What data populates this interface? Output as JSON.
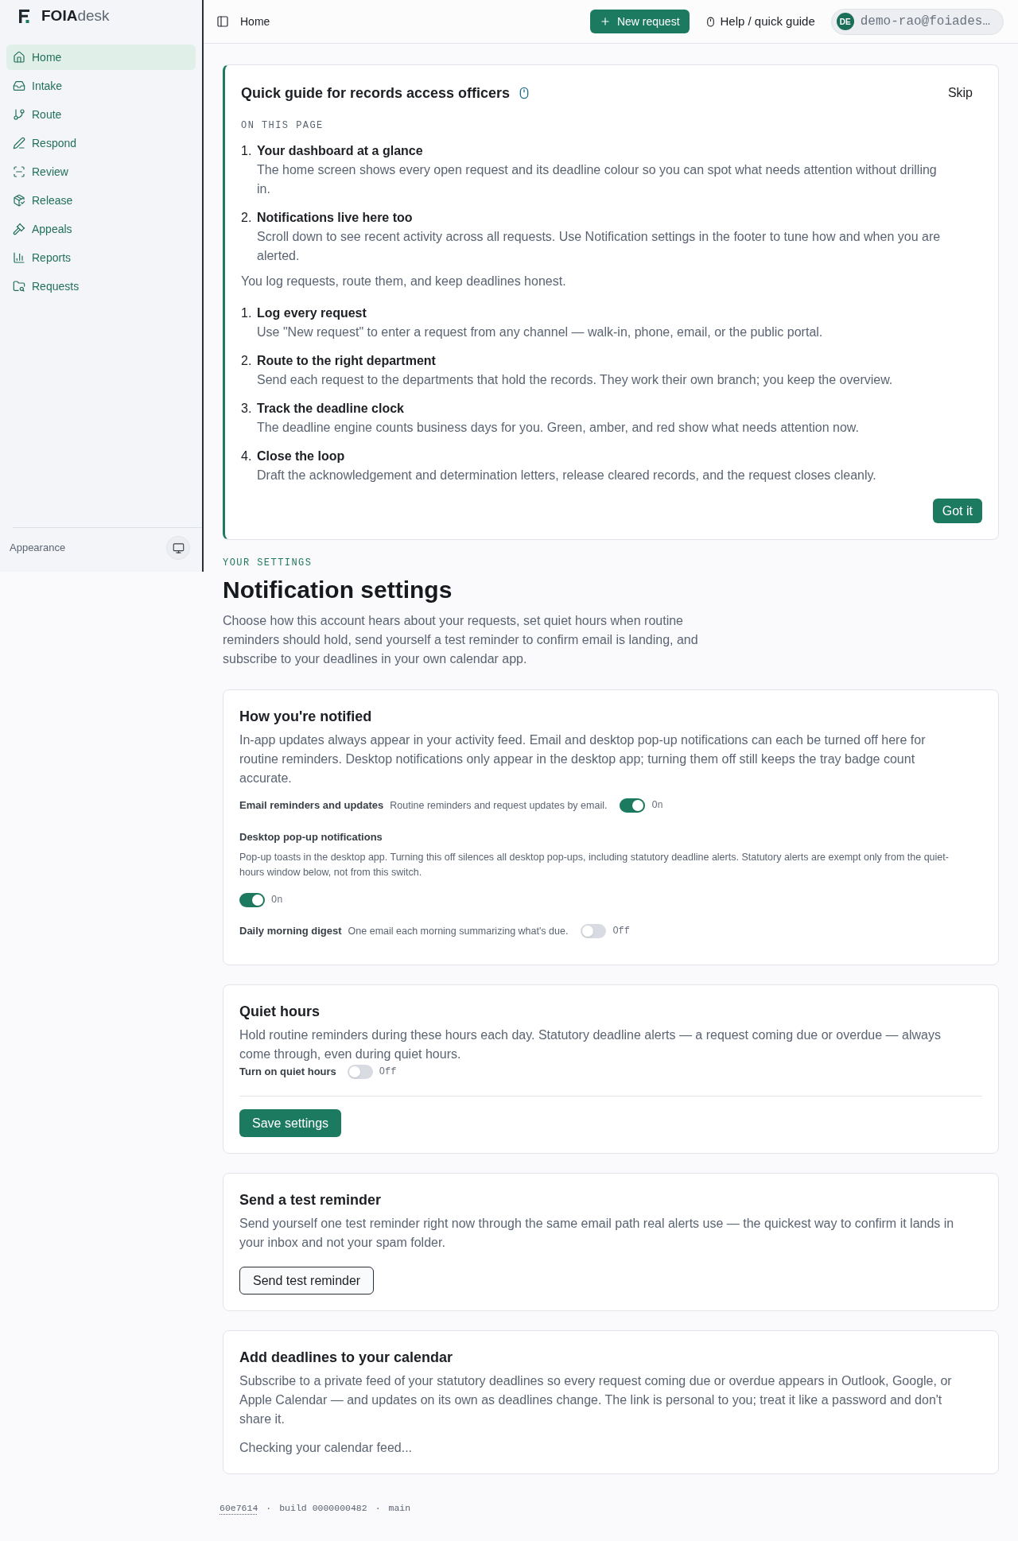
{
  "sidebar": {
    "brand": "**FOIA**desk",
    "items": [
      {
        "label": "Home",
        "selected": true
      },
      {
        "label": "Intake",
        "selected": false
      },
      {
        "label": "Route",
        "selected": false
      },
      {
        "label": "Respond",
        "selected": false
      },
      {
        "label": "Review",
        "selected": false
      },
      {
        "label": "Release",
        "selected": false
      },
      {
        "label": "Appeals",
        "selected": false
      },
      {
        "label": "Reports",
        "selected": false
      },
      {
        "label": "Requests",
        "selected": false
      }
    ],
    "footer": {
      "label": "Appearance"
    }
  },
  "header": {
    "breadcrumb": "Home",
    "new_request": "New request",
    "help": "Help / quick guide",
    "user": {
      "initials": "DE",
      "email": "demo-rao@foiades…"
    }
  },
  "guide": {
    "title": "Quick guide for records access officers",
    "skip": "Skip",
    "section_label": "ON THIS PAGE",
    "page_items": [
      {
        "number": "1.",
        "title": "Your dashboard at a glance",
        "text": "The home screen shows every open request and its deadline colour so you can spot what needs attention without drilling in."
      },
      {
        "number": "2.",
        "title": "Notifications live here too",
        "text": "Scroll down to see recent activity across all requests. Use Notification settings in the footer to tune how and when you are alerted."
      }
    ],
    "intro": "You log requests, route them, and keep deadlines honest.",
    "steps": [
      {
        "number": "1.",
        "title": "Log every request",
        "text": "Use \"New request\" to enter a request from any channel — walk-in, phone, email, or the public portal."
      },
      {
        "number": "2.",
        "title": "Route to the right department",
        "text": "Send each request to the departments that hold the records. They work their own branch; you keep the overview."
      },
      {
        "number": "3.",
        "title": "Track the deadline clock",
        "text": "The deadline engine counts business days for you. Green, amber, and red show what needs attention now."
      },
      {
        "number": "4.",
        "title": "Close the loop",
        "text": "Draft the acknowledgement and determination letters, release cleared records, and the request closes cleanly."
      }
    ],
    "dismiss": "Got it"
  },
  "settings": {
    "eyebrow": "YOUR SETTINGS",
    "title": "Notification settings",
    "intro": "Choose how this account hears about your requests, set quiet hours when routine reminders should hold, send yourself a test reminder to confirm email is landing, and subscribe to your deadlines in your own calendar app.",
    "cards": [
      {
        "kind": "toggles",
        "title": "How you're notified",
        "description": "In-app updates always appear in your activity feed. Email and desktop pop-up notifications can each be turned off here for routine reminders. Desktop notifications only appear in the desktop app; turning them off still keeps the tray badge count accurate.",
        "toggles": [
          {
            "kind": "inline",
            "label": "Email reminders and updates",
            "description": "Routine reminders and request updates by email.",
            "on": true,
            "state_label": "On"
          },
          {
            "kind": "stacked",
            "label": "Desktop pop-up notifications",
            "description": "Pop-up toasts in the desktop app. Turning this off silences all desktop pop-ups, including statutory deadline alerts. Statutory alerts are exempt only from the quiet-hours window below, not from this switch.",
            "on": true,
            "state_label": "On"
          },
          {
            "kind": "inline",
            "label": "Daily morning digest",
            "description": "One email each morning summarizing what's due.",
            "on": false,
            "state_label": "Off"
          }
        ]
      },
      {
        "kind": "form",
        "title": "Quiet hours",
        "description": "Hold routine reminders during these hours each day. Statutory deadline alerts — a request coming due or overdue — always come through, even during quiet hours.",
        "toggles": [
          {
            "kind": "inline",
            "label": "Turn on quiet hours",
            "on": false,
            "state_label": "Off"
          }
        ],
        "button": "Save settings"
      },
      {
        "kind": "action",
        "title": "Send a test reminder",
        "description": "Send yourself one test reminder right now through the same email path real alerts use — the quickest way to confirm it lands in your inbox and not your spam folder.",
        "button": "Send test reminder"
      },
      {
        "kind": "status",
        "title": "Add deadlines to your calendar",
        "description": "Subscribe to a private feed of your statutory deadlines so every request coming due or overdue appears in Outlook, Google, or Apple Calendar — and updates on its own as deadlines change. The link is personal to you; treat it like a password and don't share it.",
        "status": "Checking your calendar feed..."
      }
    ]
  },
  "footer": {
    "parts": [
      {
        "kind": "link",
        "text": "60e7614"
      },
      {
        "kind": "separator",
        "text": "·"
      },
      {
        "kind": "text",
        "text": "build 0000000482"
      },
      {
        "kind": "separator",
        "text": "·"
      },
      {
        "kind": "text",
        "text": "main"
      }
    ]
  }
}
